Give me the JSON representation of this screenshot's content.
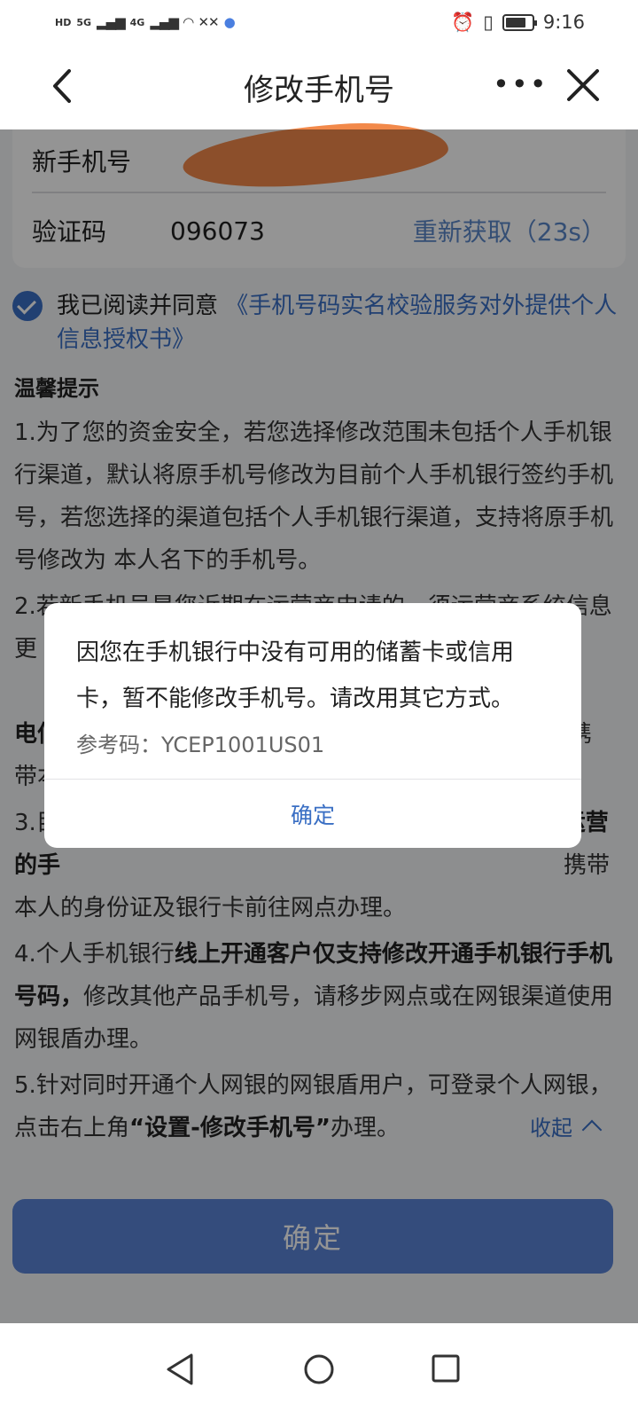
{
  "status_bar": {
    "left_indicators": [
      "HD",
      "5G",
      "4G"
    ],
    "time": "9:16"
  },
  "nav": {
    "title": "修改手机号"
  },
  "form": {
    "phone_label": "新手机号",
    "code_label": "验证码",
    "code_value": "096073",
    "resend_label": "重新获取（23s）"
  },
  "agreement": {
    "checked": true,
    "prefix": "我已阅读并同意",
    "link": "《手机号码实名校验服务对外提供个人信息授权书》"
  },
  "tips": {
    "title": "温馨提示",
    "item1": "1.为了您的资金安全，若您选择修改范围未包括个人手机银行渠道，默认将原手机号修改为目前个人手机银行签约手机号，若您选择的渠道包括个人手机银行渠道，支持将原手机号修改为 本人名下的手机号。",
    "item2_visible_start": "2.若新手机号是您近期在运营商申请的，须运营商系统信息更",
    "item2_visible_line2_end": "），",
    "item2_visible_line3_start": "电信",
    "item2_visible_line3_end": "请携",
    "item2_visible_line4_start": "带本",
    "item3_visible_start": "3.目",
    "item3_visible_end": "运营",
    "item3_line2_start": "的手",
    "item3_line2_end": "携带",
    "item3_line3": "本人的身份证及银行卡前往网点办理。",
    "item4_prefix": "4.个人手机银行",
    "item4_bold": "线上开通客户仅支持修改开通手机银行手机号码，",
    "item4_suffix": "修改其他产品手机号，请移步网点或在网银渠道使用网银盾办理。",
    "item5_prefix": "5.针对同时开通个人网银的网银盾用户，可登录个人网银，点击右上角",
    "item5_bold": "“设置-修改手机号”",
    "item5_suffix": "办理。",
    "collapse_label": "收起"
  },
  "submit_label": "确定",
  "dialog": {
    "message": "因您在手机银行中没有可用的储蓄卡或信用卡，暂不能修改手机号。请改用其它方式。",
    "ref_label": "参考码：YCEP1001US01",
    "ok_label": "确定"
  },
  "colors": {
    "accent": "#3a6fc4",
    "button": "#5a84d6",
    "redaction": "#f2894a"
  }
}
